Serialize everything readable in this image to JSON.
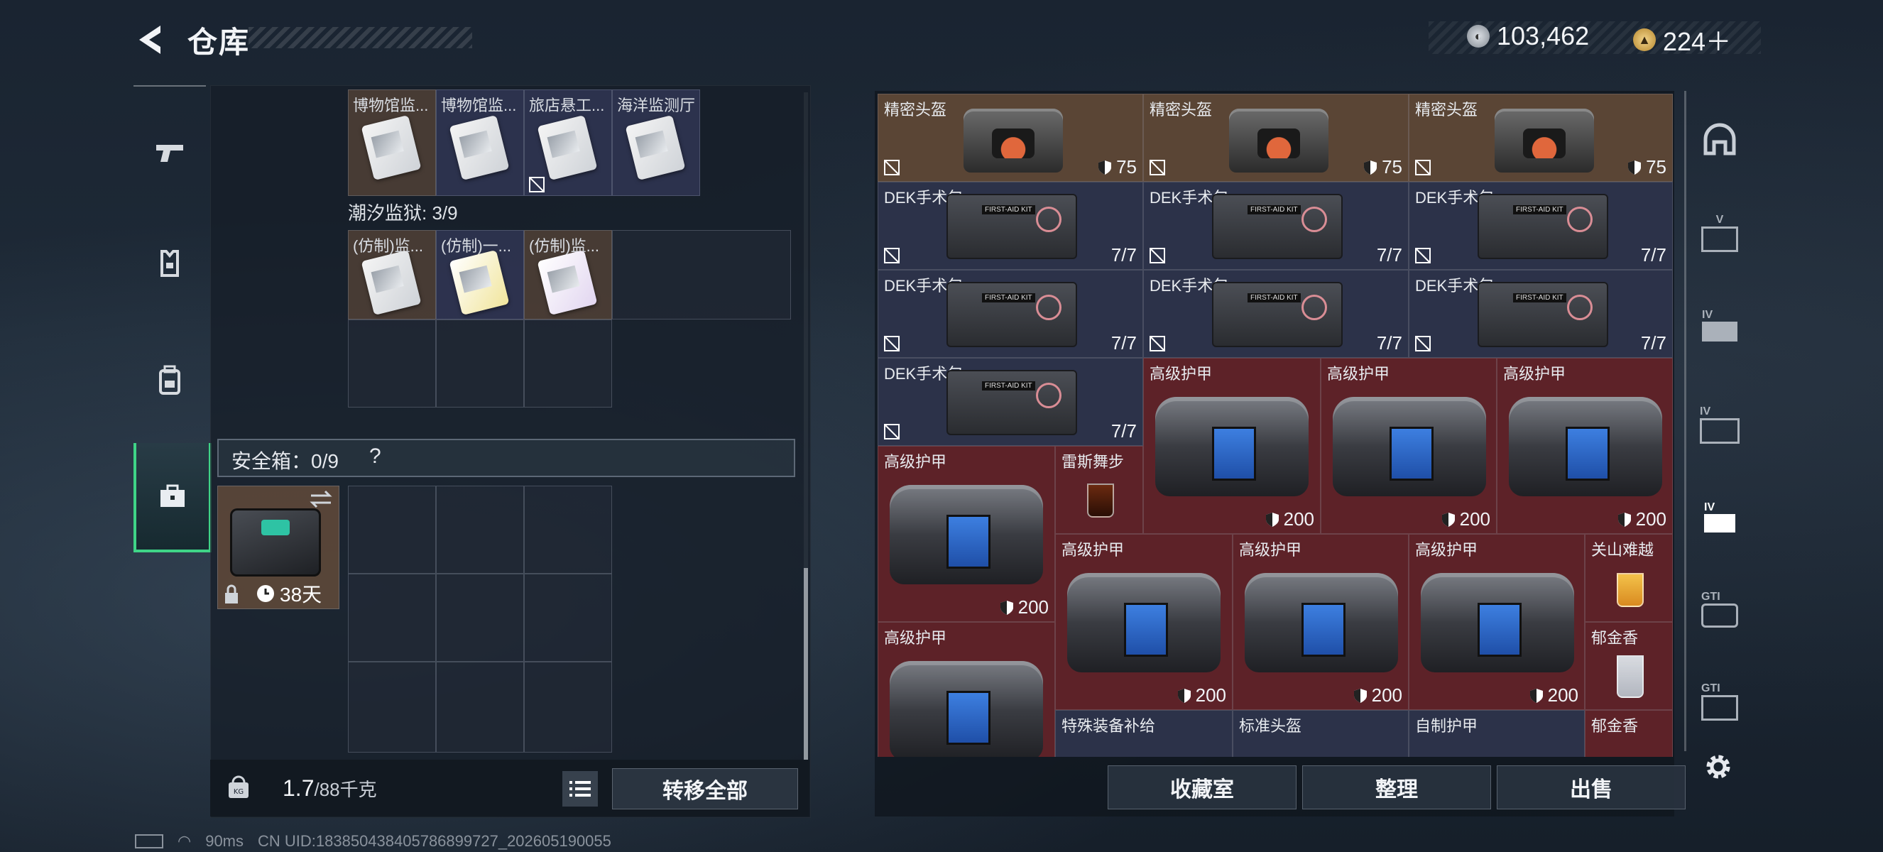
{
  "header": {
    "title": "仓库",
    "currency_silver": "103,462",
    "currency_gold": "224＋"
  },
  "left_tabs": [
    {
      "icon": "pistol-icon"
    },
    {
      "icon": "armor-vest-icon"
    },
    {
      "icon": "backpack-icon"
    },
    {
      "icon": "toolbox-icon",
      "active": true
    }
  ],
  "left_panel": {
    "top_row": [
      "博物馆监...",
      "博物馆监...",
      "旅店悬工...",
      "海洋监测厅"
    ],
    "prison_section": "潮汐监狱: 3/9",
    "prison_items": [
      "(仿制)监...",
      "(仿制)一...",
      "(仿制)监..."
    ],
    "safe_box": {
      "label": "安全箱：0/9",
      "help": "?",
      "timer": "38天"
    },
    "weight": {
      "current": "1.7",
      "max": "/88千克"
    },
    "transfer_all": "转移全部"
  },
  "right_grid": {
    "helmets": [
      {
        "name": "精密头盔",
        "value": "75"
      },
      {
        "name": "精密头盔",
        "value": "75"
      },
      {
        "name": "精密头盔",
        "value": "75"
      }
    ],
    "medkits": [
      {
        "name": "DEK手术包",
        "value": "7/7"
      },
      {
        "name": "DEK手术包",
        "value": "7/7"
      },
      {
        "name": "DEK手术包",
        "value": "7/7"
      },
      {
        "name": "DEK手术包",
        "value": "7/7"
      },
      {
        "name": "DEK手术包",
        "value": "7/7"
      },
      {
        "name": "DEK手术包",
        "value": "7/7"
      },
      {
        "name": "DEK手术包",
        "value": "7/7"
      }
    ],
    "armor": [
      {
        "name": "高级护甲",
        "value": "200"
      },
      {
        "name": "高级护甲",
        "value": "200"
      },
      {
        "name": "高级护甲",
        "value": "200"
      },
      {
        "name": "高级护甲",
        "value": "200"
      },
      {
        "name": "高级护甲",
        "value": "200"
      },
      {
        "name": "高级护甲",
        "value": "200"
      },
      {
        "name": "高级护甲",
        "value": "200"
      },
      {
        "name": "高级护甲"
      }
    ],
    "drinks": [
      {
        "name": "雷斯舞步"
      },
      {
        "name": "关山难越"
      },
      {
        "name": "郁金香"
      },
      {
        "name": "郁金香"
      }
    ],
    "bottom_row": [
      "特殊装备补给",
      "标准头盔",
      "自制护甲"
    ]
  },
  "right_rail": [
    {
      "icon": "helmet-tab-icon",
      "label": ""
    },
    {
      "icon": "v-tab-icon",
      "label": "V"
    },
    {
      "icon": "iv-armor-tab-icon",
      "label": "IV"
    },
    {
      "icon": "iv-backpack-tab-icon",
      "label": "IV"
    },
    {
      "icon": "iv-medkit-tab-icon",
      "label": "IV"
    },
    {
      "icon": "gti-tab-icon",
      "label": "GTI"
    },
    {
      "icon": "gti-tab-2-icon",
      "label": "GTI"
    }
  ],
  "bottom_buttons": {
    "collection": "收藏室",
    "sort": "整理",
    "sell": "出售"
  },
  "status_bar": {
    "ping": "90ms",
    "uid": "CN UID:18385043840578689​9727_202605190055"
  }
}
